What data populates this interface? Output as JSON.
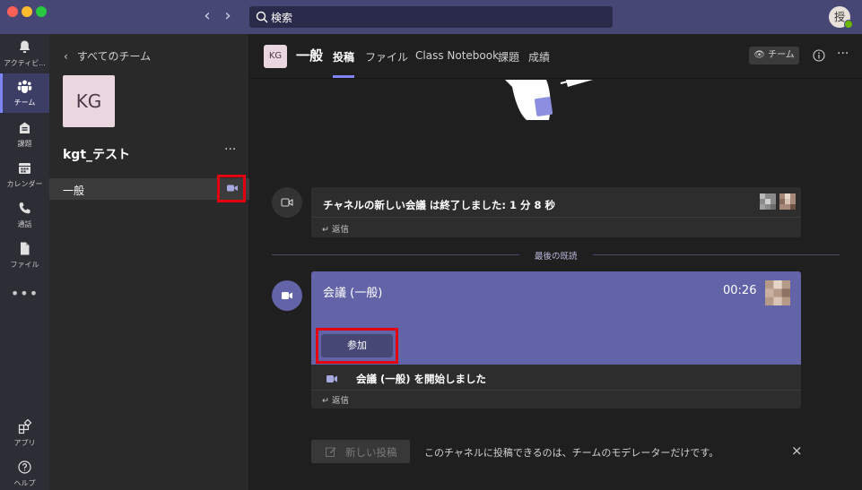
{
  "titlebar": {
    "search_placeholder": "検索",
    "me_initial": "授"
  },
  "rail": {
    "items": [
      {
        "label": "アクティビ...",
        "icon": "bell-icon"
      },
      {
        "label": "チーム",
        "icon": "teams-icon"
      },
      {
        "label": "課題",
        "icon": "assignments-icon"
      },
      {
        "label": "カレンダー",
        "icon": "calendar-icon"
      },
      {
        "label": "通話",
        "icon": "phone-icon"
      },
      {
        "label": "ファイル",
        "icon": "file-icon"
      }
    ],
    "more": "•••",
    "apps_label": "アプリ",
    "help_label": "ヘルプ"
  },
  "panel": {
    "back_label": "すべてのチーム",
    "team_initials": "KG",
    "team_name": "kgt_テスト",
    "more": "···",
    "channel": "一般"
  },
  "header": {
    "avatar": "KG",
    "title": "一般",
    "tabs": [
      "投稿",
      "ファイル",
      "Class Notebook",
      "課題",
      "成績"
    ],
    "team_button": "チーム",
    "more": "···"
  },
  "messages": {
    "ended": {
      "text": "チャネルの新しい会議 は終了しました: 1 分 8 秒",
      "reply": "返信"
    },
    "last_read": "最後の既読",
    "meeting": {
      "title": "会議 (一般)",
      "time": "00:26",
      "join_label": "参加",
      "started_text": "会議 (一般) を開始しました",
      "reply": "返信"
    }
  },
  "compose": {
    "new_post_label": "新しい投稿",
    "notice": "このチャネルに投稿できるのは、チームのモデレーターだけです。",
    "close": "×"
  },
  "colors": {
    "titlebar": "#464775",
    "accent": "#6264a7",
    "highlight": "#e3000f"
  }
}
